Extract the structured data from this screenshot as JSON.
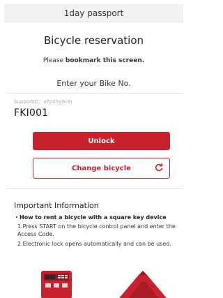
{
  "header": {
    "title": "1day passport"
  },
  "reservation": {
    "title": "Bicycle reservation",
    "note_prefix": "Please ",
    "note_bold": "bookmark this screen.",
    "enter_label": "Enter your Bike No.",
    "support_id": "SupportID：a7p25g9c8j",
    "bike_no": "FKI001"
  },
  "actions": {
    "unlock_label": "Unlock",
    "change_label": "Change bicycle"
  },
  "info": {
    "title": "Important Information",
    "subtitle": "・How to rent a bicycle with a square key device",
    "step1": "1.Press START on the bicycle control panel and enter the Access Code.",
    "step2": "2.Electronic lock opens automatically and can be used."
  },
  "colors": {
    "accent": "#c8222f",
    "header_bg": "#f2f2f2"
  },
  "icons": {
    "change": "refresh-icon",
    "device": "control-panel-image",
    "lock": "electronic-lock-image"
  }
}
